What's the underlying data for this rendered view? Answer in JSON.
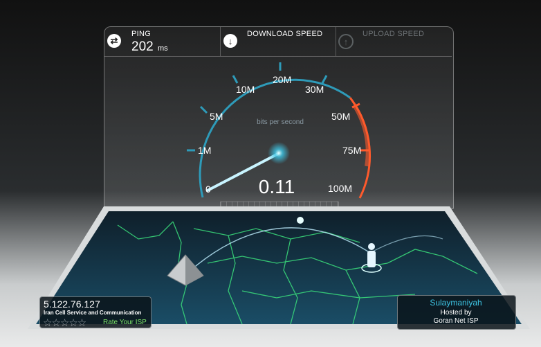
{
  "ping": {
    "label": "PING",
    "value": "202",
    "unit": "ms"
  },
  "tabs": {
    "download": "DOWNLOAD SPEED",
    "upload": "UPLOAD SPEED"
  },
  "gauge": {
    "unit_note": "bits per second",
    "reading": "0.11",
    "labels": [
      "0",
      "1M",
      "5M",
      "10M",
      "20M",
      "30M",
      "50M",
      "75M",
      "100M"
    ]
  },
  "isp": {
    "ip": "5.122.76.127",
    "name": "Iran Cell Service and Communication",
    "rate": "Rate Your ISP"
  },
  "server": {
    "city": "Sulaymaniyah",
    "hosted_label": "Hosted by",
    "host": "Goran Net ISP"
  },
  "colors": {
    "accent": "#3ec6e6",
    "red": "#ff5a2c",
    "rate": "#7ee16a"
  }
}
